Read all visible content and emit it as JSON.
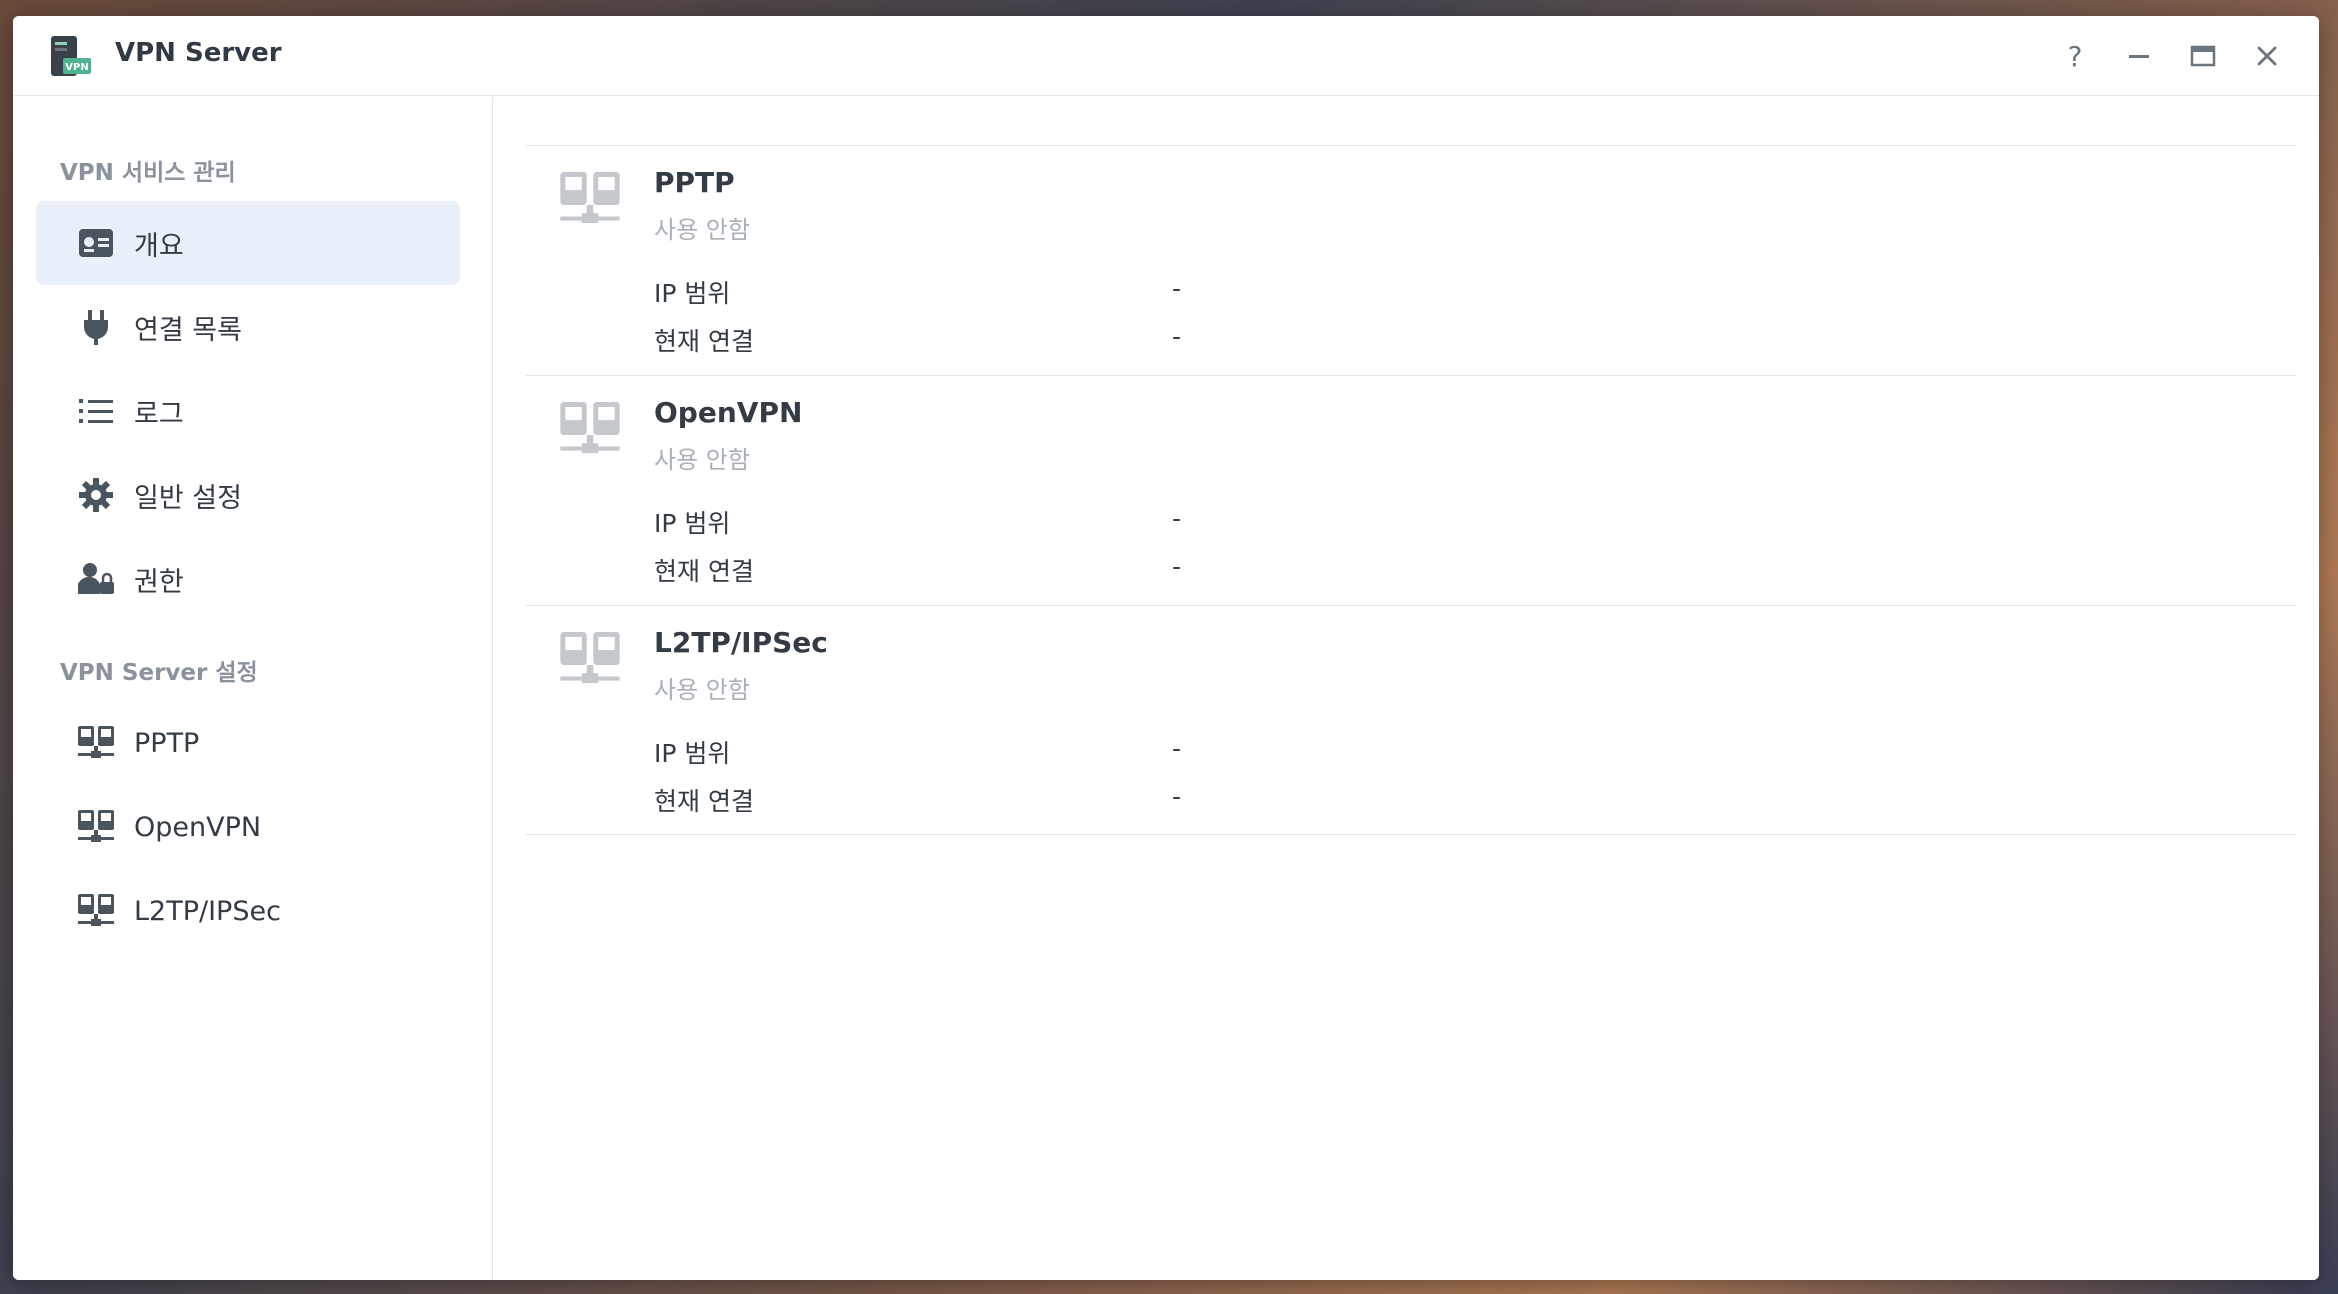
{
  "window": {
    "title": "VPN Server",
    "app_icon_badge": "VPN",
    "controls": {
      "help": "?",
      "minimize": "—",
      "maximize": "▭",
      "close": "✕"
    }
  },
  "sidebar": {
    "section1_title": "VPN 서비스 관리",
    "items1": [
      {
        "label": "개요",
        "icon": "overview-card-icon",
        "active": true
      },
      {
        "label": "연결 목록",
        "icon": "plug-icon"
      },
      {
        "label": "로그",
        "icon": "list-icon"
      },
      {
        "label": "일반 설정",
        "icon": "gear-icon"
      },
      {
        "label": "권한",
        "icon": "user-lock-icon"
      }
    ],
    "section2_title": "VPN Server 설정",
    "items2": [
      {
        "label": "PPTP",
        "icon": "network-icon"
      },
      {
        "label": "OpenVPN",
        "icon": "network-icon"
      },
      {
        "label": "L2TP/IPSec",
        "icon": "network-icon"
      }
    ]
  },
  "services": [
    {
      "name": "PPTP",
      "status": "사용 안함",
      "ip_range_label": "IP 범위",
      "ip_range_value": "-",
      "current_label": "현재 연결",
      "current_value": "-"
    },
    {
      "name": "OpenVPN",
      "status": "사용 안함",
      "ip_range_label": "IP 범위",
      "ip_range_value": "-",
      "current_label": "현재 연결",
      "current_value": "-"
    },
    {
      "name": "L2TP/IPSec",
      "status": "사용 안함",
      "ip_range_label": "IP 범위",
      "ip_range_value": "-",
      "current_label": "현재 연결",
      "current_value": "-"
    }
  ],
  "colors": {
    "active_bg": "#e9f0fa",
    "icon_gray": "#c4c8cd",
    "text_dark": "#333b44",
    "muted": "#a9b0b8"
  }
}
